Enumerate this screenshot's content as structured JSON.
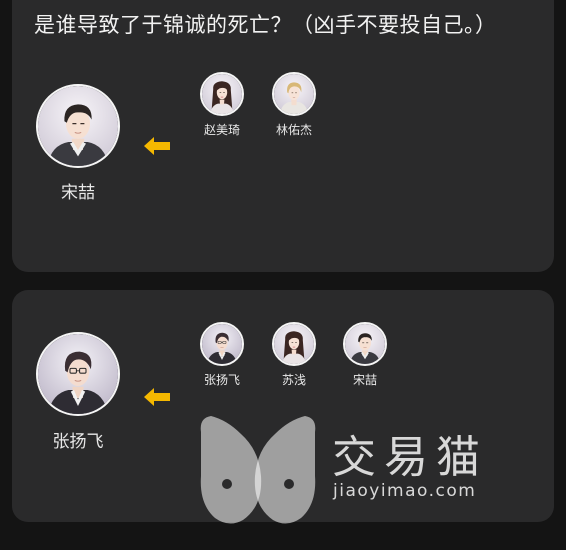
{
  "question": "是谁导致了于锦诚的死亡？（凶手不要投自己。）",
  "colors": {
    "accent_arrow": "#f5b800",
    "card_bg": "#2a2a2b",
    "page_bg": "#141414"
  },
  "rows": [
    {
      "main": {
        "name": "宋喆",
        "icon": "male-avatar-portrait"
      },
      "options": [
        {
          "name": "赵美琦",
          "icon": "female-avatar-portrait"
        },
        {
          "name": "林佑杰",
          "icon": "male-blond-avatar-portrait"
        }
      ]
    },
    {
      "main": {
        "name": "张扬飞",
        "icon": "male-glasses-avatar-portrait"
      },
      "options": [
        {
          "name": "张扬飞",
          "icon": "male-glasses-avatar-portrait"
        },
        {
          "name": "苏浅",
          "icon": "female-avatar-portrait"
        },
        {
          "name": "宋喆",
          "icon": "male-avatar-portrait"
        }
      ]
    }
  ],
  "watermark": {
    "brand": "交易猫",
    "url": "jiaoyimao.com"
  }
}
